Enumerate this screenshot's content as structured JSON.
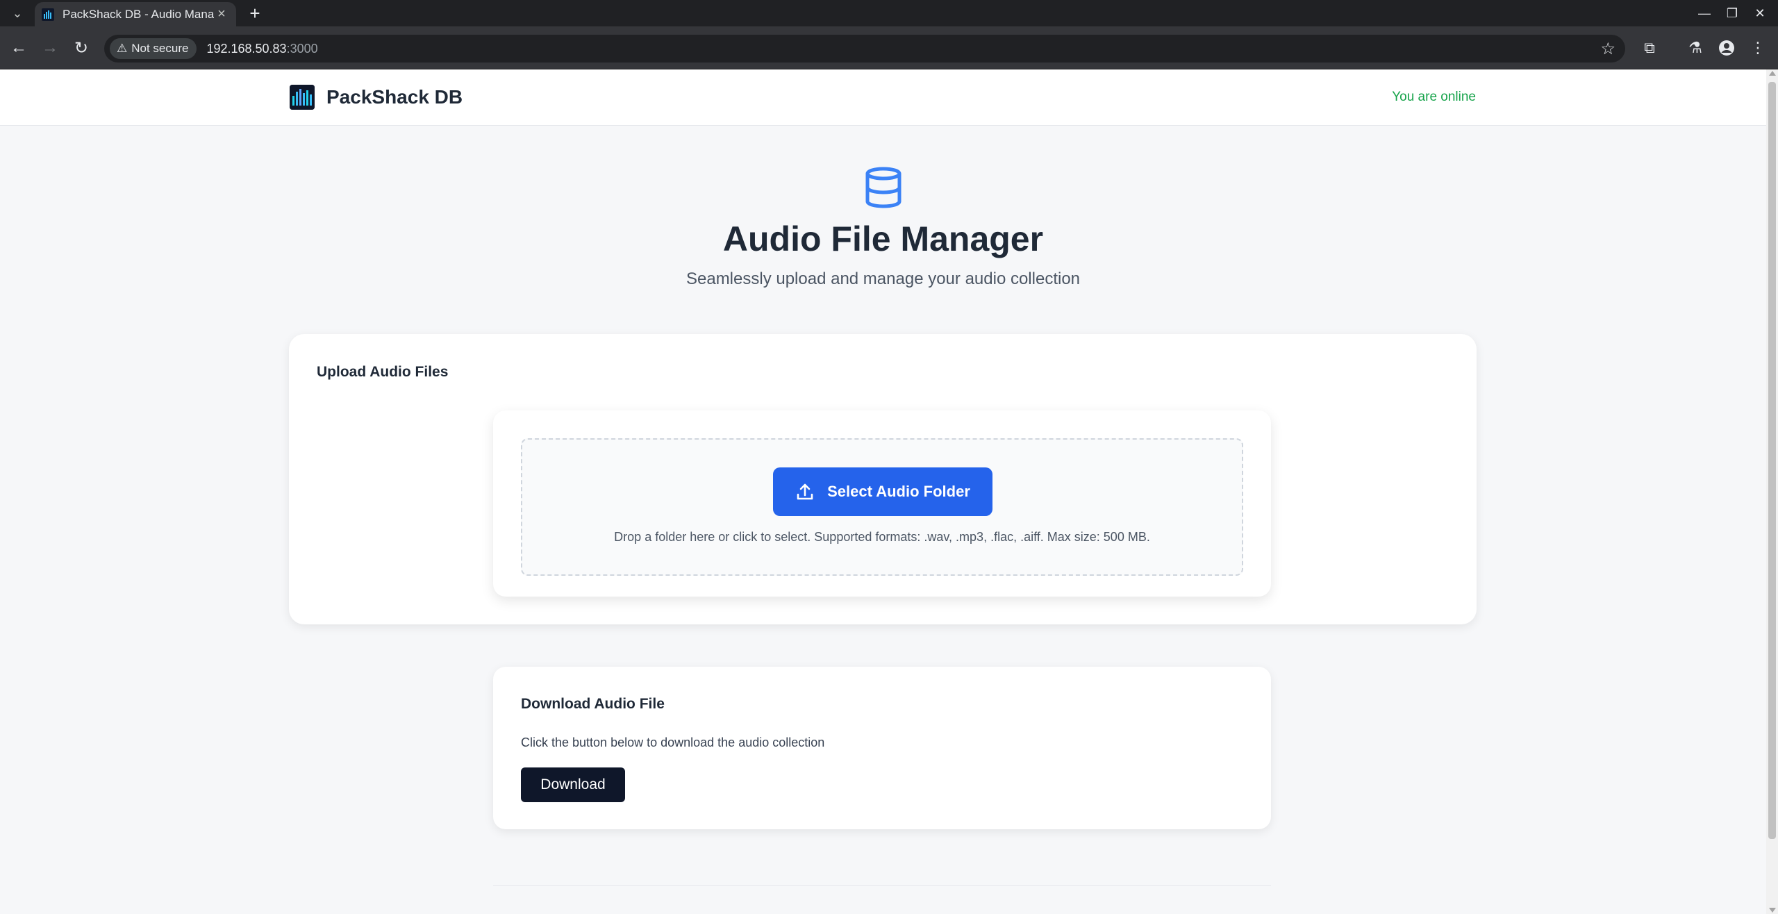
{
  "browser": {
    "tab_title": "PackShack DB - Audio Manager",
    "security_label": "Not secure",
    "url_host": "192.168.50.83",
    "url_port": ":3000"
  },
  "header": {
    "brand": "PackShack DB",
    "status": "You are online",
    "status_color": "#16a34a"
  },
  "hero": {
    "icon": "database-icon",
    "title": "Audio File Manager",
    "subtitle": "Seamlessly upload and manage your audio collection"
  },
  "upload": {
    "title": "Upload Audio Files",
    "button_label": "Select Audio Folder",
    "button_icon": "upload-icon",
    "hint": "Drop a folder here or click to select. Supported formats: .wav, .mp3, .flac, .aiff. Max size: 500 MB."
  },
  "download": {
    "title": "Download Audio File",
    "description": "Click the button below to download the audio collection",
    "button_label": "Download"
  },
  "colors": {
    "accent": "#2563eb",
    "dark_button": "#0f172a",
    "icon_blue": "#3b82f6"
  }
}
